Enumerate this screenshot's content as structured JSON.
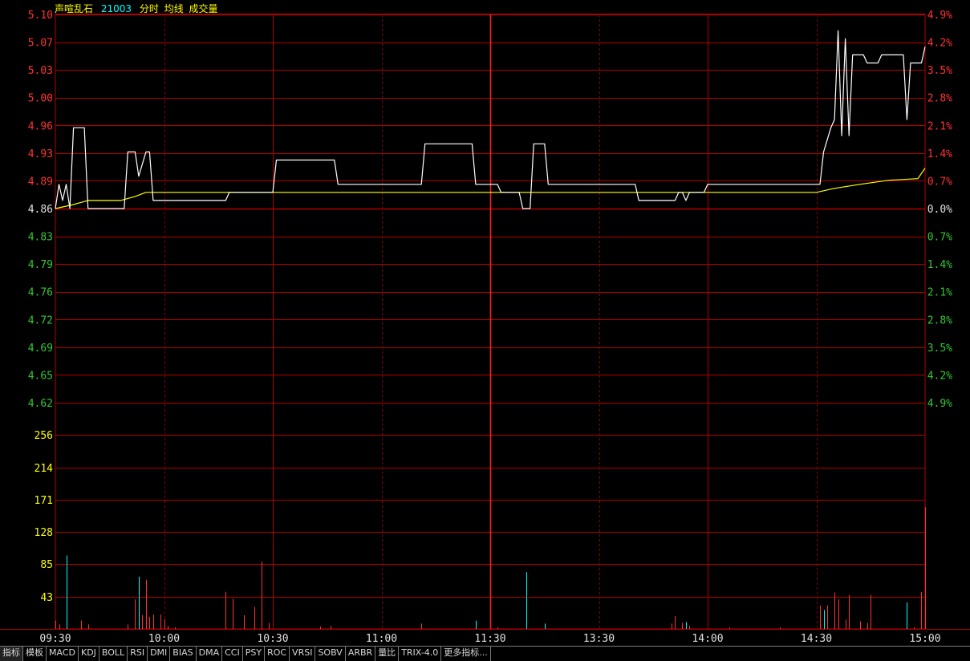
{
  "header": {
    "stock_name": "声喧乱石",
    "stock_code": "21003",
    "mode": "分时",
    "avg_label": "均线",
    "volume_label": "成交量"
  },
  "colors": {
    "background": "#000000",
    "grid": "#b20000",
    "grid_dashed": "#8a0000",
    "up": "#ff3232",
    "down": "#32c832",
    "neutral": "#e0e0e0",
    "price_line": "#ffffff",
    "avg_line": "#ffff00",
    "volume_axis": "#ffff00",
    "header_name": "#ffff00",
    "header_code": "#00ffff",
    "vol_bar_up": "#ff3232",
    "vol_bar_down": "#00ffff"
  },
  "tabs": [
    "指标",
    "模板",
    "MACD",
    "KDJ",
    "BOLL",
    "RSI",
    "DMI",
    "BIAS",
    "DMA",
    "CCI",
    "PSY",
    "ROC",
    "VRSI",
    "SOBV",
    "ARBR",
    "量比",
    "TRIX-4.0",
    "更多指标..."
  ],
  "chart_data": {
    "type": "line",
    "prev_close": 4.86,
    "price_axis": {
      "labels": [
        "5.10",
        "5.07",
        "5.03",
        "5.00",
        "4.96",
        "4.93",
        "4.89",
        "4.86",
        "4.83",
        "4.79",
        "4.76",
        "4.72",
        "4.69",
        "4.65",
        "4.62"
      ],
      "ylim": [
        4.62,
        5.1
      ]
    },
    "percent_axis": {
      "labels": [
        "4.9%",
        "4.2%",
        "3.5%",
        "2.8%",
        "2.1%",
        "1.4%",
        "0.7%",
        "0.0%",
        "0.7%",
        "1.4%",
        "2.1%",
        "2.8%",
        "3.5%",
        "4.2%",
        "4.9%"
      ]
    },
    "volume_axis": {
      "labels": [
        "256",
        "214",
        "171",
        "128",
        "85",
        "43"
      ],
      "ylim": [
        0,
        299
      ]
    },
    "time_axis": {
      "labels": [
        "09:30",
        "10:00",
        "10:30",
        "11:00",
        "11:30",
        "13:30",
        "14:00",
        "14:30",
        "15:00"
      ],
      "minutes": [
        0,
        30,
        60,
        90,
        120,
        150,
        180,
        210,
        240
      ]
    },
    "series": [
      {
        "key": "price",
        "points": [
          [
            0,
            4.86
          ],
          [
            1,
            4.89
          ],
          [
            2,
            4.87
          ],
          [
            3,
            4.89
          ],
          [
            4,
            4.86
          ],
          [
            5,
            4.96
          ],
          [
            7,
            4.96
          ],
          [
            8,
            4.96
          ],
          [
            9,
            4.86
          ],
          [
            12,
            4.86
          ],
          [
            18,
            4.86
          ],
          [
            19,
            4.86
          ],
          [
            20,
            4.93
          ],
          [
            22,
            4.93
          ],
          [
            23,
            4.9
          ],
          [
            25,
            4.93
          ],
          [
            26,
            4.93
          ],
          [
            27,
            4.87
          ],
          [
            40,
            4.87
          ],
          [
            47,
            4.87
          ],
          [
            48,
            4.88
          ],
          [
            60,
            4.88
          ],
          [
            61,
            4.92
          ],
          [
            71,
            4.92
          ],
          [
            77,
            4.92
          ],
          [
            78,
            4.89
          ],
          [
            95,
            4.89
          ],
          [
            101,
            4.89
          ],
          [
            102,
            4.94
          ],
          [
            108,
            4.94
          ],
          [
            115,
            4.94
          ],
          [
            116,
            4.89
          ],
          [
            122,
            4.89
          ],
          [
            123,
            4.88
          ],
          [
            128,
            4.88
          ],
          [
            129,
            4.86
          ],
          [
            131,
            4.86
          ],
          [
            132,
            4.94
          ],
          [
            135,
            4.94
          ],
          [
            136,
            4.89
          ],
          [
            159,
            4.89
          ],
          [
            160,
            4.89
          ],
          [
            161,
            4.87
          ],
          [
            171,
            4.87
          ],
          [
            172,
            4.88
          ],
          [
            173,
            4.88
          ],
          [
            174,
            4.87
          ],
          [
            175,
            4.88
          ],
          [
            179,
            4.88
          ],
          [
            180,
            4.89
          ],
          [
            200,
            4.89
          ],
          [
            211,
            4.89
          ],
          [
            212,
            4.93
          ],
          [
            214,
            4.96
          ],
          [
            215,
            4.97
          ],
          [
            216,
            5.08
          ],
          [
            217,
            4.95
          ],
          [
            218,
            5.07
          ],
          [
            219,
            4.95
          ],
          [
            220,
            5.05
          ],
          [
            223,
            5.05
          ],
          [
            224,
            5.04
          ],
          [
            227,
            5.04
          ],
          [
            228,
            5.05
          ],
          [
            234,
            5.05
          ],
          [
            235,
            4.97
          ],
          [
            236,
            5.04
          ],
          [
            239,
            5.04
          ],
          [
            240,
            5.06
          ]
        ]
      },
      {
        "key": "average",
        "points": [
          [
            0,
            4.86
          ],
          [
            5,
            4.865
          ],
          [
            9,
            4.87
          ],
          [
            18,
            4.87
          ],
          [
            22,
            4.875
          ],
          [
            25,
            4.88
          ],
          [
            40,
            4.88
          ],
          [
            60,
            4.88
          ],
          [
            77,
            4.88
          ],
          [
            101,
            4.88
          ],
          [
            115,
            4.88
          ],
          [
            135,
            4.88
          ],
          [
            180,
            4.88
          ],
          [
            200,
            4.88
          ],
          [
            210,
            4.88
          ],
          [
            215,
            4.885
          ],
          [
            222,
            4.89
          ],
          [
            230,
            4.895
          ],
          [
            238,
            4.897
          ],
          [
            240,
            4.91
          ]
        ]
      }
    ],
    "volume": [
      {
        "t": 0,
        "v": 11
      },
      {
        "t": 1,
        "v": 6
      },
      {
        "t": 3,
        "v": 97
      },
      {
        "t": 7,
        "v": 11
      },
      {
        "t": 9,
        "v": 6
      },
      {
        "t": 20,
        "v": 6
      },
      {
        "t": 22,
        "v": 39
      },
      {
        "t": 23,
        "v": 69
      },
      {
        "t": 24,
        "v": 18
      },
      {
        "t": 25,
        "v": 65
      },
      {
        "t": 26,
        "v": 16
      },
      {
        "t": 27,
        "v": 19
      },
      {
        "t": 29,
        "v": 19
      },
      {
        "t": 30,
        "v": 13
      },
      {
        "t": 31,
        "v": 4
      },
      {
        "t": 33,
        "v": 2
      },
      {
        "t": 47,
        "v": 49
      },
      {
        "t": 49,
        "v": 40
      },
      {
        "t": 52,
        "v": 18
      },
      {
        "t": 55,
        "v": 29
      },
      {
        "t": 57,
        "v": 89
      },
      {
        "t": 59,
        "v": 8
      },
      {
        "t": 73,
        "v": 3
      },
      {
        "t": 76,
        "v": 4
      },
      {
        "t": 101,
        "v": 7
      },
      {
        "t": 116,
        "v": 11
      },
      {
        "t": 122,
        "v": 2
      },
      {
        "t": 130,
        "v": 75
      },
      {
        "t": 135,
        "v": 7
      },
      {
        "t": 170,
        "v": 7
      },
      {
        "t": 171,
        "v": 17
      },
      {
        "t": 173,
        "v": 8
      },
      {
        "t": 174,
        "v": 9
      },
      {
        "t": 175,
        "v": 4
      },
      {
        "t": 186,
        "v": 2
      },
      {
        "t": 200,
        "v": 2
      },
      {
        "t": 211,
        "v": 31
      },
      {
        "t": 212,
        "v": 25
      },
      {
        "t": 213,
        "v": 31
      },
      {
        "t": 215,
        "v": 48
      },
      {
        "t": 216,
        "v": 39
      },
      {
        "t": 218,
        "v": 12
      },
      {
        "t": 219,
        "v": 45
      },
      {
        "t": 222,
        "v": 10
      },
      {
        "t": 224,
        "v": 8
      },
      {
        "t": 225,
        "v": 45
      },
      {
        "t": 235,
        "v": 35
      },
      {
        "t": 237,
        "v": 2
      },
      {
        "t": 239,
        "v": 49
      },
      {
        "t": 240,
        "v": 161
      }
    ]
  }
}
